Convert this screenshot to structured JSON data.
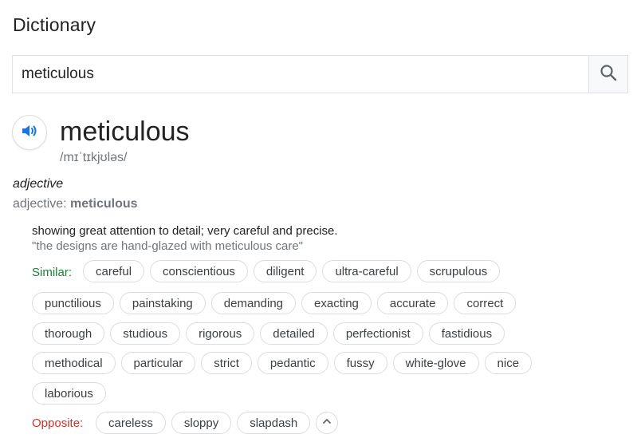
{
  "header": {
    "title": "Dictionary"
  },
  "search": {
    "value": "meticulous"
  },
  "entry": {
    "word": "meticulous",
    "phonetic": "/mɪˈtɪkjʊləs/",
    "pos_italic": "adjective",
    "pos_prefix": "adjective: ",
    "pos_word": "meticulous",
    "definition": "showing great attention to detail; very careful and precise.",
    "example": "\"the designs are hand-glazed with meticulous care\""
  },
  "similar": {
    "label": "Similar:",
    "rows": [
      [
        "careful",
        "conscientious",
        "diligent",
        "ultra-careful",
        "scrupulous"
      ],
      [
        "punctilious",
        "painstaking",
        "demanding",
        "exacting",
        "accurate",
        "correct"
      ],
      [
        "thorough",
        "studious",
        "rigorous",
        "detailed",
        "perfectionist",
        "fastidious"
      ],
      [
        "methodical",
        "particular",
        "strict",
        "pedantic",
        "fussy",
        "white-glove",
        "nice"
      ],
      [
        "laborious"
      ]
    ]
  },
  "opposite": {
    "label": "Opposite:",
    "items": [
      "careless",
      "sloppy",
      "slapdash"
    ]
  },
  "colors": {
    "similar_label": "#188038",
    "opposite_label": "#d93025",
    "speaker_icon": "#1a73e8"
  },
  "icons": {
    "search": "search-icon",
    "speaker": "speaker-icon",
    "collapse": "chevron-up-icon"
  }
}
